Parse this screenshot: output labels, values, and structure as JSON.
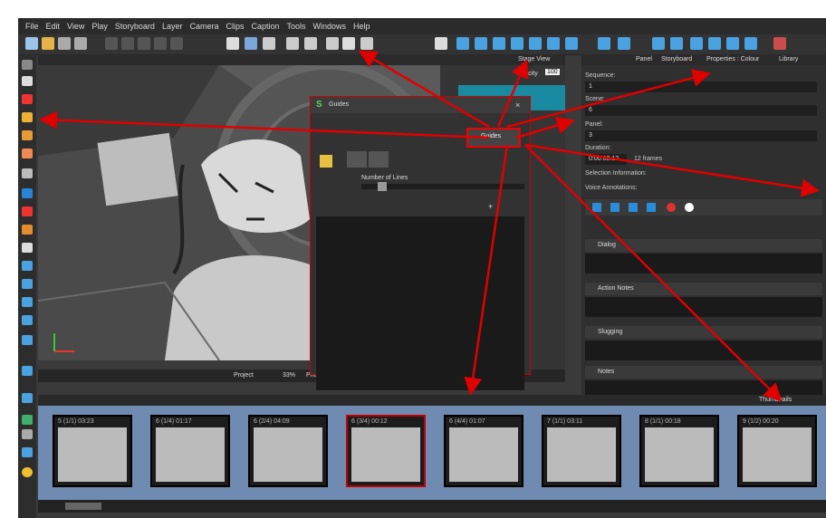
{
  "menu": [
    "File",
    "Edit",
    "View",
    "Play",
    "Storyboard",
    "Layer",
    "Camera",
    "Clips",
    "Caption",
    "Tools",
    "Windows",
    "Help"
  ],
  "stage": {
    "tab": "Stage View",
    "opacity_label": "Opacity",
    "opacity_value": "100",
    "zoom": "33%",
    "project_label": "Project",
    "photo_label": "Photo"
  },
  "guides": {
    "title": "Guides",
    "num_lines_label": "Number of Lines",
    "callout": "Guides"
  },
  "right_panel": {
    "tabs": [
      "Panel",
      "Storyboard",
      "Properties : Colour",
      "Library"
    ],
    "sequence_label": "Sequence:",
    "sequence_value": "1",
    "scene_label": "Scene:",
    "scene_value": "6",
    "panel_label": "Panel:",
    "panel_value": "3",
    "duration_label": "Duration:",
    "duration_value": "0:00:00.12",
    "frames_value": "12 frames",
    "selection_info": "Selection Information:",
    "voice_annotations": "Voice Annotations:",
    "sections": [
      "Dialog",
      "Action Notes",
      "Slugging",
      "Notes"
    ]
  },
  "thumbnails": {
    "tab": "Thumbnails",
    "items": [
      "5 (1/1) 03:23",
      "6 (1/4) 01:17",
      "6 (2/4) 04:09",
      "6 (3/4) 00:12",
      "6 (4/4) 01:07",
      "7 (1/1) 03:11",
      "8 (1/1) 00:18",
      "9 (1/2) 00:20"
    ],
    "selected_index": 3
  },
  "colors": {
    "arrow": "#e00000",
    "accent": "#1c8fd6",
    "selected_border": "#c00000"
  }
}
